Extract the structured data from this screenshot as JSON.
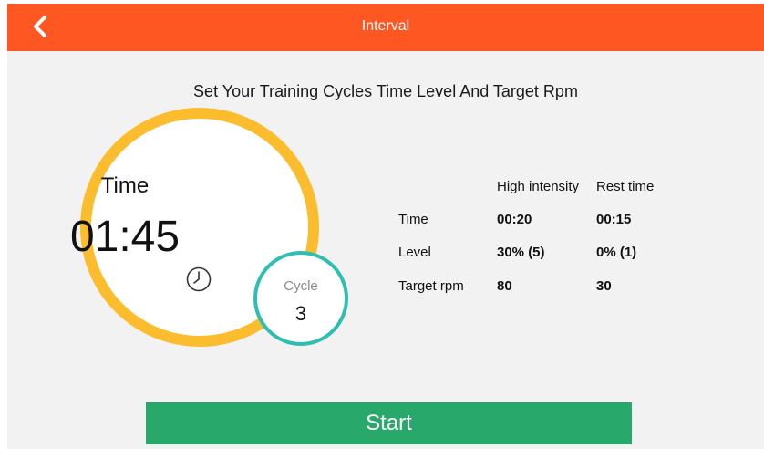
{
  "header": {
    "title": "Interval",
    "back_icon": "chevron-left-icon",
    "color": "#ff5722"
  },
  "subtitle": "Set Your Training Cycles Time Level And Target Rpm",
  "dial": {
    "label": "Time",
    "value": "01:45",
    "icon": "clock-icon",
    "ring_color": "#fbbc2e"
  },
  "cycle": {
    "label": "Cycle",
    "value": "3",
    "ring_color": "#2ebfb0"
  },
  "settings": {
    "columns": [
      "High intensity",
      "Rest time"
    ],
    "rows": [
      {
        "label": "Time",
        "high": "00:20",
        "rest": "00:15"
      },
      {
        "label": "Level",
        "high": "30% (5)",
        "rest": "0% (1)"
      },
      {
        "label": "Target rpm",
        "high": "80",
        "rest": "30"
      }
    ]
  },
  "start_button": {
    "label": "Start",
    "color": "#28a86b"
  }
}
